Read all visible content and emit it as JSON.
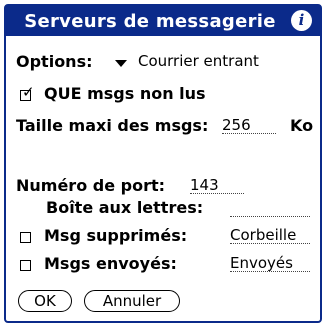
{
  "dialog": {
    "title": "Serveurs de messagerie",
    "info_icon": "i"
  },
  "options": {
    "label": "Options:",
    "selected": "Courrier entrant"
  },
  "unread_only": {
    "label": "QUE msgs non lus",
    "checked": true
  },
  "max_size": {
    "label": "Taille maxi des msgs:",
    "value": "256",
    "unit": "Ko"
  },
  "port": {
    "label": "Numéro de port:",
    "value": "143"
  },
  "mailbox": {
    "label": "Boîte aux lettres:",
    "value": ""
  },
  "deleted": {
    "label": "Msg supprimés:",
    "value": "Corbeille",
    "checked": false
  },
  "sent": {
    "label": "Msgs envoyés:",
    "value": "Envoyés",
    "checked": false
  },
  "buttons": {
    "ok": "OK",
    "cancel": "Annuler"
  }
}
